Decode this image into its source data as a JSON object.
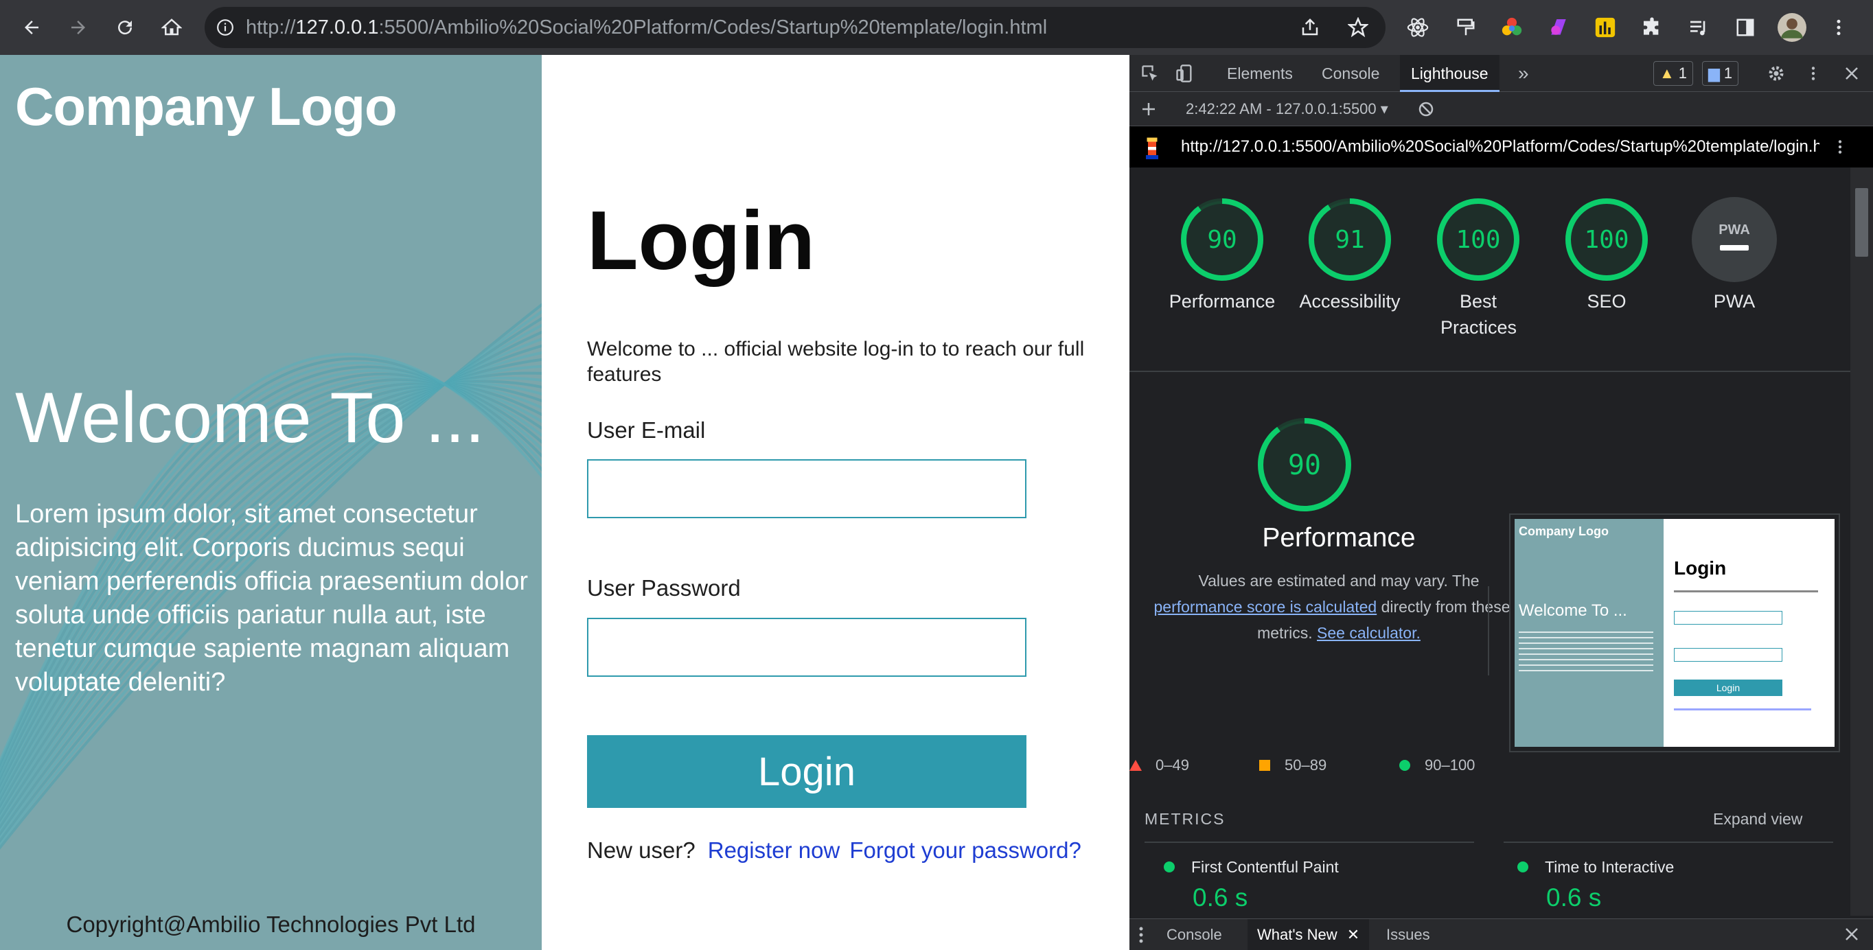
{
  "browser": {
    "url_prefix": "http://",
    "url_host": "127.0.0.1",
    "url_rest": ":5500/Ambilio%20Social%20Platform/Codes/Startup%20template/login.html"
  },
  "page": {
    "company_logo": "Company Logo",
    "welcome_heading": "Welcome To ...",
    "lorem": "Lorem ipsum dolor, sit amet consectetur adipisicing elit. Corporis ducimus sequi veniam perferendis officia praesentium dolor soluta unde officiis pariatur nulla aut, iste tenetur cumque sapiente magnam aliquam voluptate deleniti?",
    "copyright": "Copyright@Ambilio Technologies Pvt Ltd",
    "login_title": "Login",
    "welcome_text": "Welcome to ... official website log-in to to reach our full features",
    "email_label": "User E-mail",
    "email_value": "",
    "password_label": "User Password",
    "password_value": "",
    "login_button": "Login",
    "new_user": "New user?",
    "register_link": "Register now",
    "forgot_link": "Forgot your password?"
  },
  "devtools": {
    "tabs": [
      "Elements",
      "Console",
      "Lighthouse"
    ],
    "active_tab": "Lighthouse",
    "more_tabs": "»",
    "warnings_count": "1",
    "messages_count": "1",
    "report_selector": "2:42:22 AM - 127.0.0.1:5500",
    "report_url": "http://127.0.0.1:5500/Ambilio%20Social%20Platform/Codes/Startup%20template/login.h...",
    "scores": [
      {
        "label": "Performance",
        "value": "90"
      },
      {
        "label": "Accessibility",
        "value": "91"
      },
      {
        "label": "Best Practices",
        "value": "100"
      },
      {
        "label": "SEO",
        "value": "100"
      },
      {
        "label": "PWA",
        "value": "PWA"
      }
    ],
    "perf_score": "90",
    "perf_title": "Performance",
    "perf_desc_1": "Values are estimated and may vary. The",
    "perf_desc_link": "performance score is calculated",
    "perf_desc_2": " directly from these",
    "perf_desc_3": "metrics.",
    "perf_desc_calc": "See calculator.",
    "legend": [
      "0–49",
      "50–89",
      "90–100"
    ],
    "metrics_heading": "METRICS",
    "expand_view": "Expand view",
    "metrics": [
      {
        "name": "First Contentful Paint",
        "value": "0.6 s"
      },
      {
        "name": "Time to Interactive",
        "value": "0.6 s"
      }
    ],
    "thumbnail": {
      "logo": "Company Logo",
      "welcome": "Welcome To ...",
      "login_title": "Login",
      "login_button": "Login"
    },
    "drawer_tabs": [
      "Console",
      "What's New",
      "Issues"
    ],
    "colors": {
      "pass": "#0cce6b",
      "average": "#ffa400",
      "fail": "#ff4e42"
    }
  }
}
